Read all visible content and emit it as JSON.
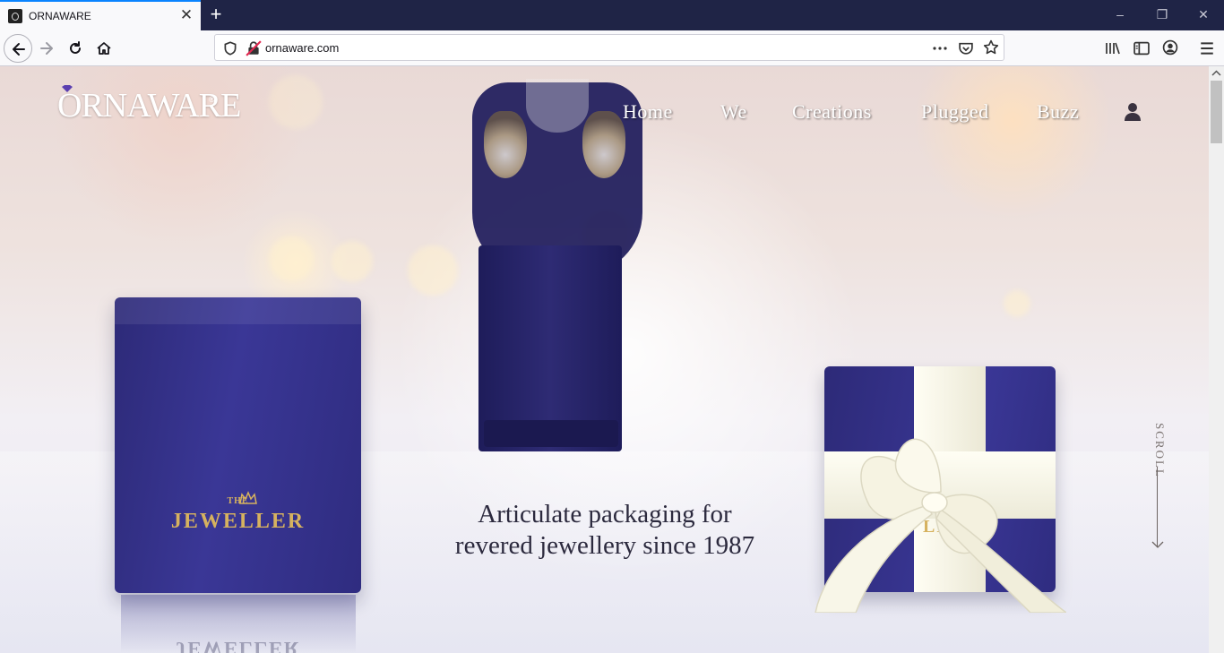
{
  "browser": {
    "tab_title": "ORNAWARE",
    "tab_close": "✕",
    "new_tab": "+",
    "url": "ornaware.com",
    "window_controls": {
      "minimize": "–",
      "restore": "❐",
      "close": "✕"
    },
    "icons": [
      "back-icon",
      "forward-icon",
      "reload-icon",
      "home-icon",
      "shield-icon",
      "insecure-lock-icon",
      "page-actions-icon",
      "pocket-icon",
      "bookmark-star-icon",
      "library-icon",
      "sidebar-icon",
      "account-icon",
      "menu-icon"
    ]
  },
  "site": {
    "logo": "ORNAWARE",
    "logo_reg": "®",
    "nav": [
      "Home",
      "We",
      "Creations",
      "Plugged",
      "Buzz"
    ],
    "hero_line1": "Articulate packaging for",
    "hero_line2": "revered jewellery since 1987",
    "scroll_label": "SCROLL",
    "box_brand_small": "THE",
    "box_brand": "JEWELLER",
    "box_brand_partial": "LE",
    "reflection_text": "JEWELLER"
  },
  "colors": {
    "chrome_dark": "#1f2446",
    "tab_accent": "#0a84ff",
    "box_navy": "#2f2c80",
    "gold": "#d6b25f",
    "hero_text": "#2c2a3e"
  }
}
